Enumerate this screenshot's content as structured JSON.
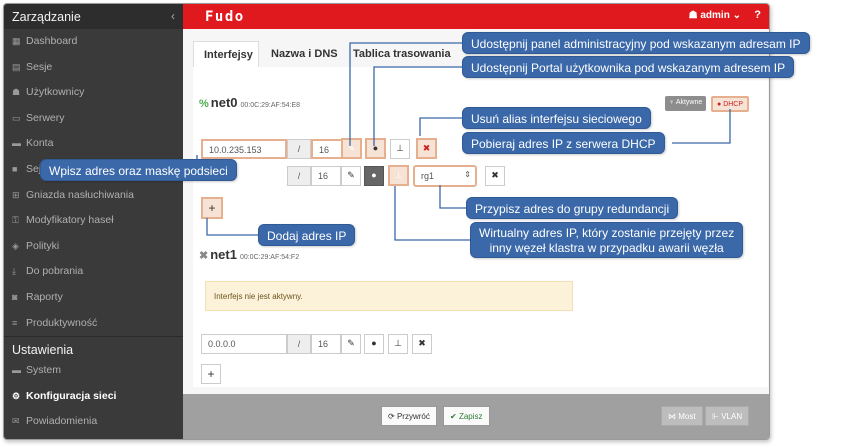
{
  "sidebar": {
    "header": "Zarządzanie",
    "items": [
      {
        "label": "Dashboard",
        "icon": "dashboard-icon",
        "glyph": "▦"
      },
      {
        "label": "Sesje",
        "icon": "film-icon",
        "glyph": "▤"
      },
      {
        "label": "Użytkownicy",
        "icon": "users-icon",
        "glyph": "☗"
      },
      {
        "label": "Serwery",
        "icon": "server-icon",
        "glyph": "▭"
      },
      {
        "label": "Konta",
        "icon": "folder-icon",
        "glyph": "▬"
      },
      {
        "label": "Sejfy",
        "icon": "safe-icon",
        "glyph": "■"
      },
      {
        "label": "Gniazda nasłuchiwania",
        "icon": "socket-icon",
        "glyph": "⊞"
      },
      {
        "label": "Modyfikatory haseł",
        "icon": "key-icon",
        "glyph": "⚿"
      },
      {
        "label": "Polityki",
        "icon": "shield-icon",
        "glyph": "◈"
      },
      {
        "label": "Do pobrania",
        "icon": "download-icon",
        "glyph": "⤓"
      },
      {
        "label": "Raporty",
        "icon": "car-icon",
        "glyph": "◙"
      },
      {
        "label": "Produktywność",
        "icon": "list-icon",
        "glyph": "≡"
      }
    ],
    "section2": "Ustawienia",
    "items2": [
      {
        "label": "System",
        "icon": "folder-icon",
        "glyph": "▬",
        "active": false
      },
      {
        "label": "Konfiguracja sieci",
        "icon": "cogs-icon",
        "glyph": "⚙",
        "active": true
      },
      {
        "label": "Powiadomienia",
        "icon": "envelope-icon",
        "glyph": "✉",
        "active": false
      }
    ]
  },
  "topbar": {
    "logo": "Fudo",
    "user": "admin",
    "help": "?"
  },
  "tabs": [
    "Interfejsy",
    "Nazwa i DNS",
    "Tablica trasowania"
  ],
  "net0": {
    "name": "net0",
    "mac": "00:0C:29:AF:54:E8",
    "badge_active": "Aktywne",
    "badge_dhcp": "DHCP",
    "ip1": "10.0.235.153",
    "mask1": "16",
    "slash": "/",
    "mask2": "16",
    "group": "rg1"
  },
  "net1": {
    "name": "net1",
    "mac": "00:0C:29:AF:54:F2",
    "warning": "Interfejs nie jest aktywny.",
    "ip": "0.0.0.0",
    "mask": "16",
    "slash": "/"
  },
  "footer": {
    "revert": "Przywróć",
    "save": "Zapisz",
    "bridge": "Most",
    "vlan": "VLAN"
  },
  "callouts": {
    "admin_panel": "Udostępnij panel administracyjny pod wskazanym adresam IP",
    "user_portal": "Udostępnij Portal użytkownika pod wskazanym adresem IP",
    "remove_alias": "Usuń alias interfejsu sieciowego",
    "dhcp": "Pobieraj adres IP z serwera DHCP",
    "ip_mask": "Wpisz adres oraz maskę podsieci",
    "add_ip": "Dodaj adres IP",
    "redundancy": "Przypisz adres do grupy redundancji",
    "virtual_1": "Wirtualny adres IP, który zostanie przejęty przez",
    "virtual_2": "inny węzeł klastra w przypadku awarii węzła"
  },
  "colors": {
    "brand": "#e0191e",
    "callout": "#3a68a8",
    "highlight": "#e6b08f"
  }
}
